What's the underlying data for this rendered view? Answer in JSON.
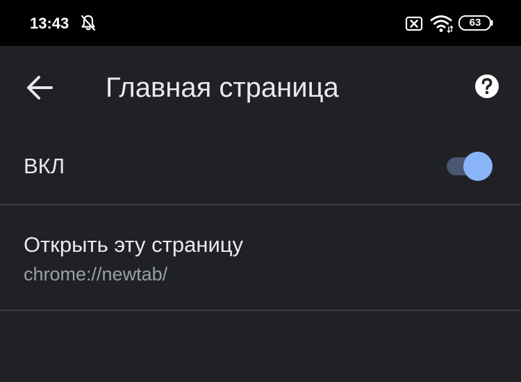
{
  "status_bar": {
    "time": "13:43",
    "battery": "63",
    "icons": [
      "bell-off-icon",
      "sim-off-icon",
      "wifi-icon",
      "battery-icon"
    ]
  },
  "toolbar": {
    "title": "Главная страница",
    "back_icon": "arrow-back-icon",
    "help_icon": "help-icon"
  },
  "settings": {
    "toggle_label": "ВКЛ",
    "toggle_state": "on",
    "page_title": "Открыть эту страницу",
    "page_url": "chrome://newtab/"
  },
  "colors": {
    "background": "#202124",
    "accent": "#8ab4f8",
    "text_primary": "#e8eaed",
    "text_secondary": "#9aa0a6"
  }
}
